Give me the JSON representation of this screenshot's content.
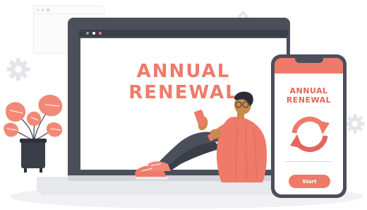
{
  "colors": {
    "accent": "#f07a6a",
    "accent_dark": "#e4655a",
    "device_dark": "#4a4f5a",
    "skin": "#c98a4c",
    "hair": "#2a2d36"
  },
  "laptop": {
    "title_line1": "ANNUAL",
    "title_line2": "RENEWAL"
  },
  "phone": {
    "title_line1": "ANNUAL",
    "title_line2": "RENEWAL",
    "start_label": "Start"
  },
  "icons": [
    "gear-icon",
    "refresh-arrows-icon",
    "monstera-plant-icon",
    "person-with-phone-illustration"
  ]
}
